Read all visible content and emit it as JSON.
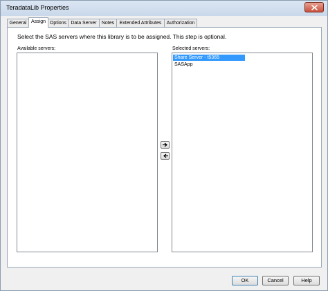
{
  "window": {
    "title": "TeradataLib Properties"
  },
  "tabs": [
    {
      "label": "General"
    },
    {
      "label": "Assign"
    },
    {
      "label": "Options"
    },
    {
      "label": "Data Server"
    },
    {
      "label": "Notes"
    },
    {
      "label": "Extended Attributes"
    },
    {
      "label": "Authorization"
    }
  ],
  "active_tab": "Assign",
  "assign": {
    "instruction": "Select the SAS servers where this library is to be assigned.  This step is optional.",
    "available_label": "Available servers:",
    "available_items": [],
    "selected_label": "Selected servers:",
    "selected_items": [
      {
        "label": "Share Server - t5365",
        "selected": true
      },
      {
        "label": "SASApp",
        "selected": false
      }
    ]
  },
  "buttons": {
    "ok": "OK",
    "cancel": "Cancel",
    "help": "Help"
  },
  "icons": {
    "close": "close-icon",
    "move_right": "arrow-right-icon",
    "move_left": "arrow-left-icon"
  }
}
